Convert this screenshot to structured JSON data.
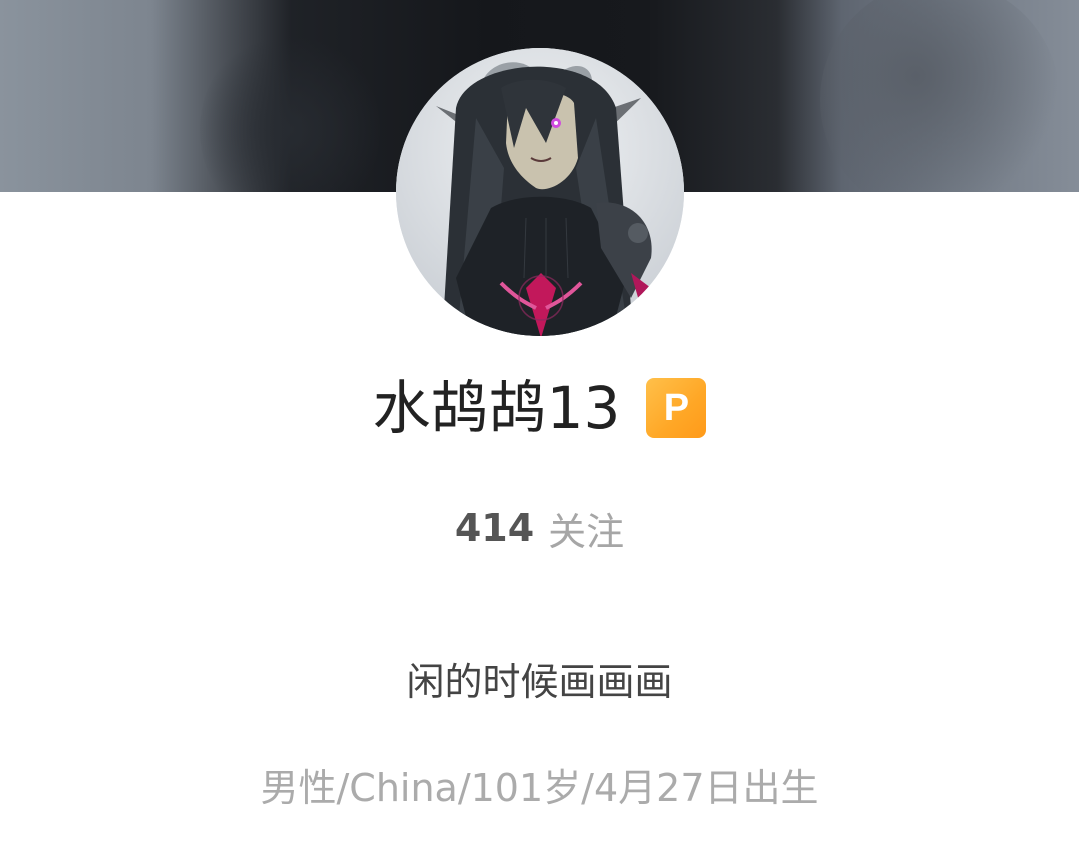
{
  "profile": {
    "name": "水鸪鸪13",
    "badge": "P",
    "follow_count": "414",
    "follow_label": "关注",
    "bio": "闲的时候画画画",
    "info": "男性/China/101岁/4月27日出生"
  },
  "colors": {
    "badge": "#ffa726",
    "name_text": "#222222",
    "secondary_text": "#a6a6a6"
  },
  "icons": {
    "avatar": "profile-avatar-image",
    "cover": "profile-cover-image"
  }
}
